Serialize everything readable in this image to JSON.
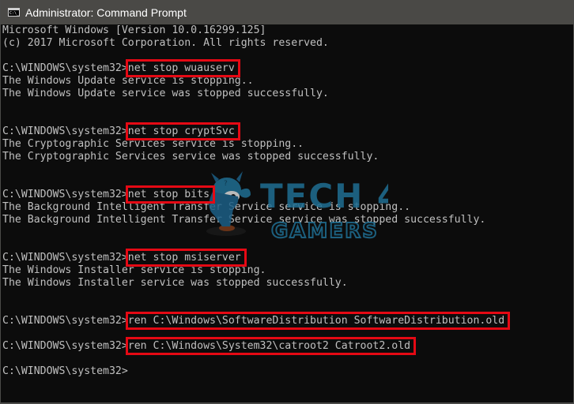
{
  "window": {
    "title": "Administrator: Command Prompt",
    "icon": "cmd-icon",
    "icon_text": "C:\\_"
  },
  "console": {
    "lines": [
      "Microsoft Windows [Version 10.0.16299.125]",
      "(c) 2017 Microsoft Corporation. All rights reserved.",
      "",
      "C:\\WINDOWS\\system32>net stop wuauserv",
      "The Windows Update service is stopping..",
      "The Windows Update service was stopped successfully.",
      "",
      "",
      "C:\\WINDOWS\\system32>net stop cryptSvc",
      "The Cryptographic Services service is stopping..",
      "The Cryptographic Services service was stopped successfully.",
      "",
      "",
      "C:\\WINDOWS\\system32>net stop bits",
      "The Background Intelligent Transfer Service service is stopping..",
      "The Background Intelligent Transfer Service service was stopped successfully.",
      "",
      "",
      "C:\\WINDOWS\\system32>net stop msiserver",
      "The Windows Installer service is stopping.",
      "The Windows Installer service was stopped successfully.",
      "",
      "",
      "C:\\WINDOWS\\system32>ren C:\\Windows\\SoftwareDistribution SoftwareDistribution.old",
      "",
      "C:\\WINDOWS\\system32>ren C:\\Windows\\System32\\catroot2 Catroot2.old",
      "",
      "C:\\WINDOWS\\system32>"
    ],
    "highlighted_commands": [
      "net stop wuauserv",
      "net stop cryptSvc",
      "net stop bits",
      "net stop msiserver",
      "ren C:\\Windows\\SoftwareDistribution SoftwareDistribution.old",
      "ren C:\\Windows\\System32\\catroot2 Catroot2.old"
    ],
    "highlight_color": "#e50914",
    "text_color": "#c0c0c0",
    "background_color": "#0c0c0c"
  },
  "watermark": {
    "line1": "TECH 4",
    "line2": "GAMERS",
    "color": "#1f6e92"
  }
}
